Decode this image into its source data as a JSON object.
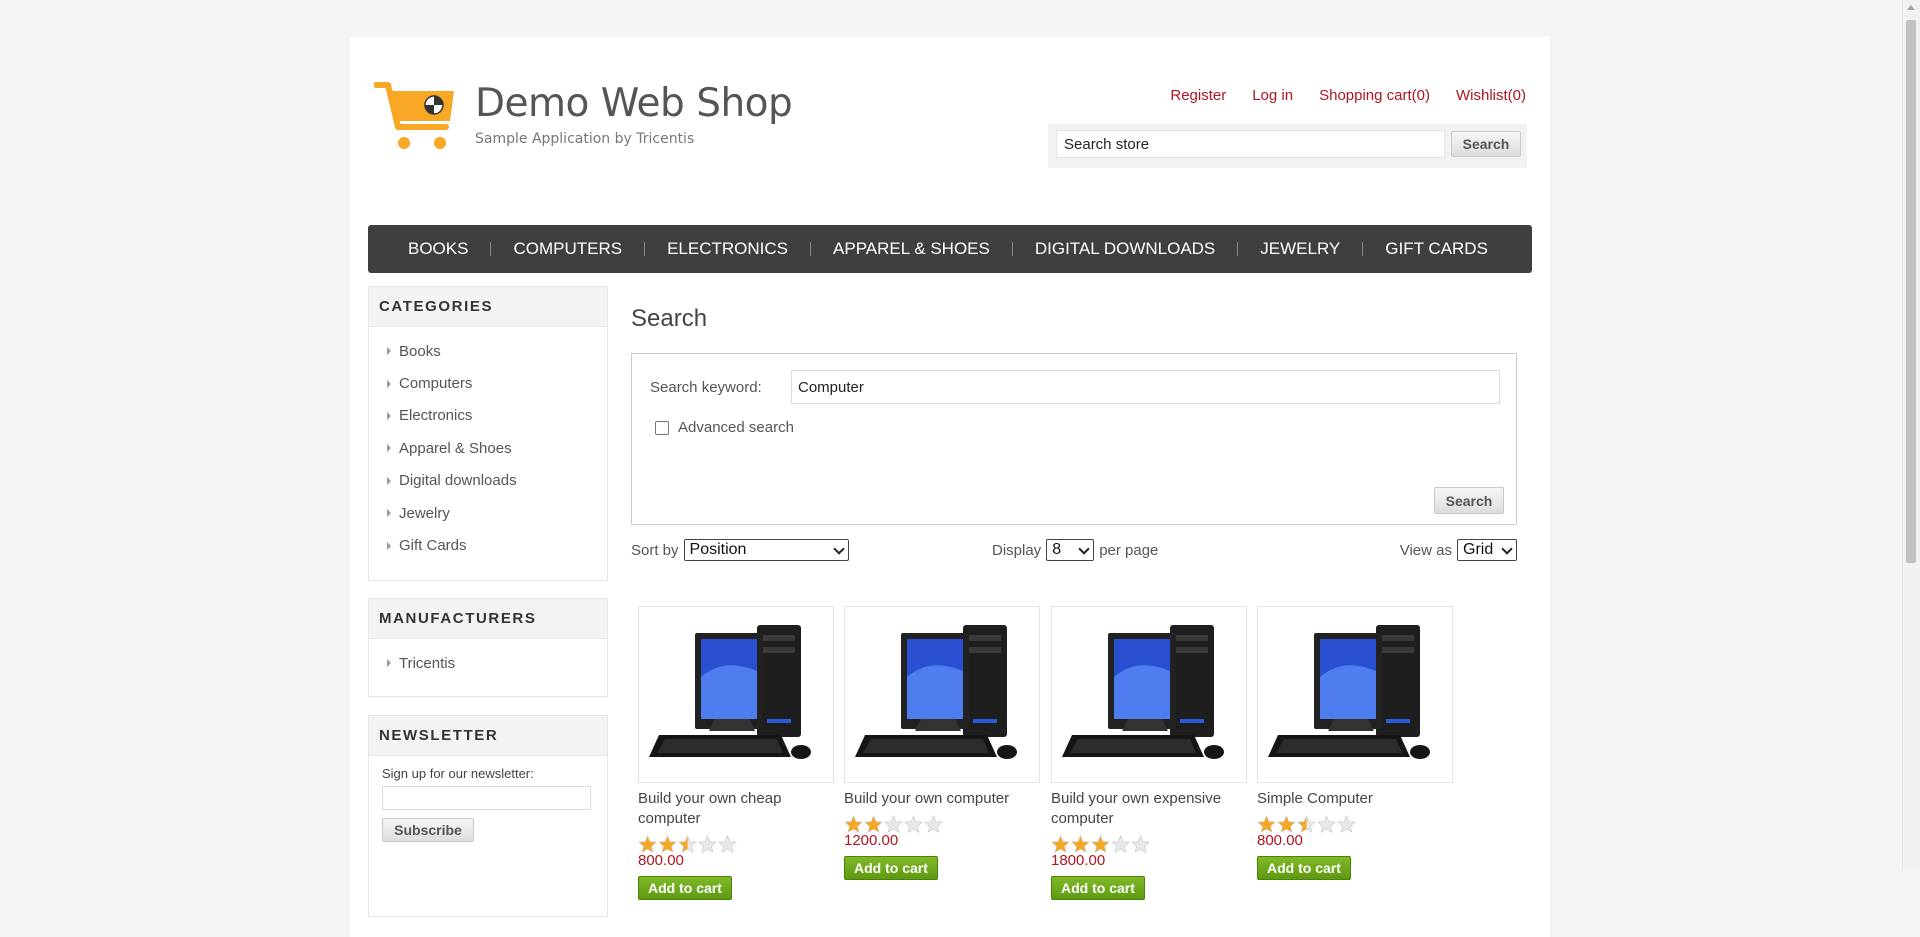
{
  "header": {
    "logo_title": "Demo Web Shop",
    "logo_subtitle": "Sample Application by Tricentis",
    "links": [
      "Register",
      "Log in",
      "Shopping cart(0)",
      "Wishlist(0)"
    ],
    "search_value": "Search store",
    "search_button": "Search"
  },
  "menu": [
    "BOOKS",
    "COMPUTERS",
    "ELECTRONICS",
    "APPAREL & SHOES",
    "DIGITAL DOWNLOADS",
    "JEWELRY",
    "GIFT CARDS"
  ],
  "sidebar": {
    "categories_title": "CATEGORIES",
    "categories": [
      "Books",
      "Computers",
      "Electronics",
      "Apparel & Shoes",
      "Digital downloads",
      "Jewelry",
      "Gift Cards"
    ],
    "manufacturers_title": "MANUFACTURERS",
    "manufacturers": [
      "Tricentis"
    ],
    "newsletter_title": "NEWSLETTER",
    "newsletter_label": "Sign up for our newsletter:",
    "subscribe_button": "Subscribe"
  },
  "main": {
    "title": "Search",
    "keyword_label": "Search keyword:",
    "keyword_value": "Computer",
    "advanced_label": "Advanced search",
    "search_button": "Search",
    "sort_label": "Sort by",
    "sort_value": "Position",
    "display_label": "Display",
    "display_value": "8",
    "per_page": "per page",
    "view_label": "View as",
    "view_value": "Grid"
  },
  "products": [
    {
      "name": "Build your own cheap computer",
      "rating": 2.5,
      "price": "800.00",
      "button": "Add to cart"
    },
    {
      "name": "Build your own computer",
      "rating": 2,
      "price": "1200.00",
      "button": "Add to cart"
    },
    {
      "name": "Build your own expensive computer",
      "rating": 3,
      "price": "1800.00",
      "button": "Add to cart"
    },
    {
      "name": "Simple Computer",
      "rating": 2.5,
      "price": "800.00",
      "button": "Add to cart"
    }
  ],
  "colors": {
    "link_red": "#b01520",
    "menu_bg": "#3f3f3f",
    "star": "#f5a623",
    "add_green": "#6fa81b",
    "logo_orange": "#f9a825"
  }
}
